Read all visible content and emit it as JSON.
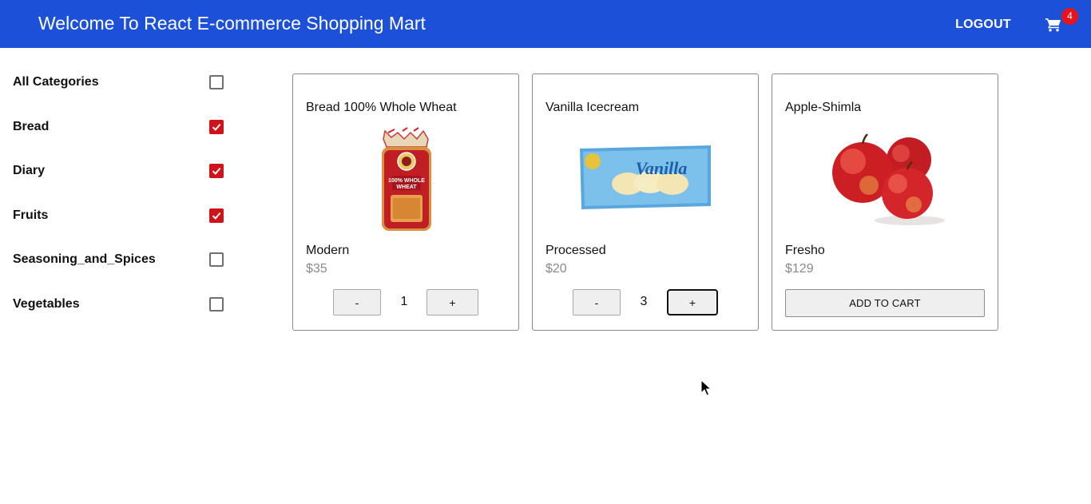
{
  "header": {
    "title": "Welcome To React E-commerce Shopping Mart",
    "logout_label": "LOGOUT",
    "cart_icon": "cart-icon",
    "cart_count": "4",
    "background_color": "#1d50d8",
    "badge_color": "#e8141c"
  },
  "sidebar": {
    "categories": [
      {
        "label": "All Categories",
        "checked": false
      },
      {
        "label": "Bread",
        "checked": true
      },
      {
        "label": "Diary",
        "checked": true
      },
      {
        "label": "Fruits",
        "checked": true
      },
      {
        "label": "Seasoning_and_Spices",
        "checked": false
      },
      {
        "label": "Vegetables",
        "checked": false
      }
    ],
    "checkbox_checked_color": "#d0121b"
  },
  "products": [
    {
      "name": "Bread 100% Whole Wheat",
      "brand": "Modern",
      "price": "$35",
      "image": "bread-loaf-image",
      "in_cart": true,
      "quantity": "1",
      "minus_label": "-",
      "plus_label": "+"
    },
    {
      "name": "Vanilla Icecream",
      "brand": "Processed",
      "price": "$20",
      "image": "vanilla-icecream-pack-image",
      "image_text": "Vanilla",
      "in_cart": true,
      "quantity": "3",
      "minus_label": "-",
      "plus_label": "+"
    },
    {
      "name": "Apple-Shimla",
      "brand": "Fresho",
      "price": "$129",
      "image": "red-apples-image",
      "in_cart": false,
      "add_label": "ADD TO CART"
    }
  ]
}
